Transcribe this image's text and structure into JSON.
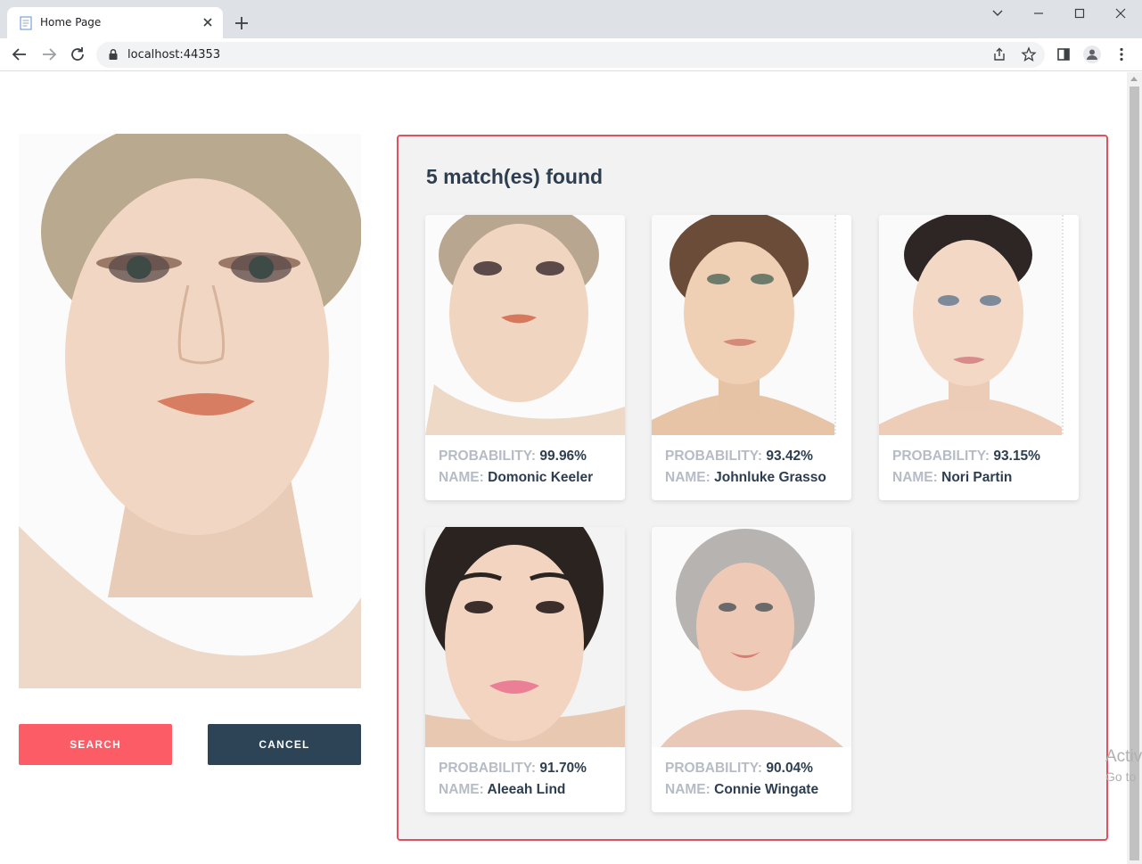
{
  "browser": {
    "tab_title": "Home Page",
    "url": "localhost:44353"
  },
  "query": {
    "search_label": "SEARCH",
    "cancel_label": "CANCEL"
  },
  "results": {
    "title": "5 match(es) found",
    "probability_label": "PROBABILITY:",
    "name_label": "NAME:",
    "matches": [
      {
        "probability": "99.96%",
        "name": "Domonic Keeler"
      },
      {
        "probability": "93.42%",
        "name": "Johnluke Grasso"
      },
      {
        "probability": "93.15%",
        "name": "Nori Partin"
      },
      {
        "probability": "91.70%",
        "name": "Aleeah Lind"
      },
      {
        "probability": "90.04%",
        "name": "Connie Wingate"
      }
    ]
  },
  "os_watermark": {
    "line1": "Activ",
    "line2": "Go to"
  },
  "colors": {
    "accent": "#fc5c65",
    "dark": "#2d4356",
    "panel_border": "#e15060",
    "panel_bg": "#f2f2f2",
    "label_gray": "#b6bcc6",
    "text_dark": "#2d3e50"
  },
  "icons": [
    "page-favicon-icon",
    "close-icon",
    "plus-icon",
    "chevron-down-icon",
    "minimize-icon",
    "maximize-icon",
    "window-close-icon",
    "back-arrow-icon",
    "forward-arrow-icon",
    "reload-icon",
    "lock-icon",
    "share-icon",
    "star-icon",
    "side-panel-icon",
    "profile-icon",
    "kebab-menu-icon"
  ]
}
